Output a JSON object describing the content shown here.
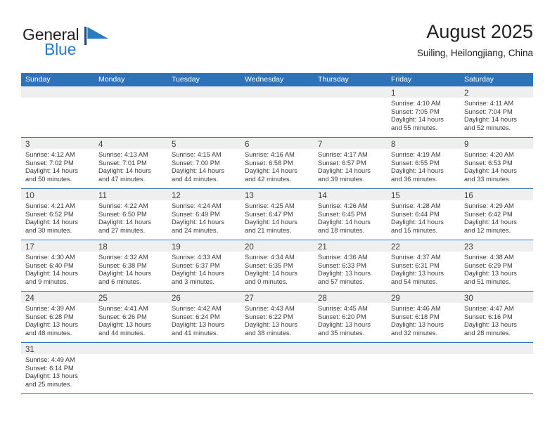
{
  "brand": {
    "name_top": "General",
    "name_bottom": "Blue",
    "flag_icon": "blue-flag-triangle-icon",
    "color_top": "#231f20",
    "color_bottom": "#2b7bbf"
  },
  "header": {
    "title": "August 2025",
    "subtitle": "Suiling, Heilongjiang, China"
  },
  "theme": {
    "header_blue": "#2e73b8",
    "day_band_gray": "#efefef",
    "text_dark": "#3a3a3a"
  },
  "weekdays": [
    "Sunday",
    "Monday",
    "Tuesday",
    "Wednesday",
    "Thursday",
    "Friday",
    "Saturday"
  ],
  "weeks": [
    [
      {
        "day": "",
        "lines": []
      },
      {
        "day": "",
        "lines": []
      },
      {
        "day": "",
        "lines": []
      },
      {
        "day": "",
        "lines": []
      },
      {
        "day": "",
        "lines": []
      },
      {
        "day": "1",
        "lines": [
          "Sunrise: 4:10 AM",
          "Sunset: 7:05 PM",
          "Daylight: 14 hours",
          "and 55 minutes."
        ]
      },
      {
        "day": "2",
        "lines": [
          "Sunrise: 4:11 AM",
          "Sunset: 7:04 PM",
          "Daylight: 14 hours",
          "and 52 minutes."
        ]
      }
    ],
    [
      {
        "day": "3",
        "lines": [
          "Sunrise: 4:12 AM",
          "Sunset: 7:02 PM",
          "Daylight: 14 hours",
          "and 50 minutes."
        ]
      },
      {
        "day": "4",
        "lines": [
          "Sunrise: 4:13 AM",
          "Sunset: 7:01 PM",
          "Daylight: 14 hours",
          "and 47 minutes."
        ]
      },
      {
        "day": "5",
        "lines": [
          "Sunrise: 4:15 AM",
          "Sunset: 7:00 PM",
          "Daylight: 14 hours",
          "and 44 minutes."
        ]
      },
      {
        "day": "6",
        "lines": [
          "Sunrise: 4:16 AM",
          "Sunset: 6:58 PM",
          "Daylight: 14 hours",
          "and 42 minutes."
        ]
      },
      {
        "day": "7",
        "lines": [
          "Sunrise: 4:17 AM",
          "Sunset: 6:57 PM",
          "Daylight: 14 hours",
          "and 39 minutes."
        ]
      },
      {
        "day": "8",
        "lines": [
          "Sunrise: 4:19 AM",
          "Sunset: 6:55 PM",
          "Daylight: 14 hours",
          "and 36 minutes."
        ]
      },
      {
        "day": "9",
        "lines": [
          "Sunrise: 4:20 AM",
          "Sunset: 6:53 PM",
          "Daylight: 14 hours",
          "and 33 minutes."
        ]
      }
    ],
    [
      {
        "day": "10",
        "lines": [
          "Sunrise: 4:21 AM",
          "Sunset: 6:52 PM",
          "Daylight: 14 hours",
          "and 30 minutes."
        ]
      },
      {
        "day": "11",
        "lines": [
          "Sunrise: 4:22 AM",
          "Sunset: 6:50 PM",
          "Daylight: 14 hours",
          "and 27 minutes."
        ]
      },
      {
        "day": "12",
        "lines": [
          "Sunrise: 4:24 AM",
          "Sunset: 6:49 PM",
          "Daylight: 14 hours",
          "and 24 minutes."
        ]
      },
      {
        "day": "13",
        "lines": [
          "Sunrise: 4:25 AM",
          "Sunset: 6:47 PM",
          "Daylight: 14 hours",
          "and 21 minutes."
        ]
      },
      {
        "day": "14",
        "lines": [
          "Sunrise: 4:26 AM",
          "Sunset: 6:45 PM",
          "Daylight: 14 hours",
          "and 18 minutes."
        ]
      },
      {
        "day": "15",
        "lines": [
          "Sunrise: 4:28 AM",
          "Sunset: 6:44 PM",
          "Daylight: 14 hours",
          "and 15 minutes."
        ]
      },
      {
        "day": "16",
        "lines": [
          "Sunrise: 4:29 AM",
          "Sunset: 6:42 PM",
          "Daylight: 14 hours",
          "and 12 minutes."
        ]
      }
    ],
    [
      {
        "day": "17",
        "lines": [
          "Sunrise: 4:30 AM",
          "Sunset: 6:40 PM",
          "Daylight: 14 hours",
          "and 9 minutes."
        ]
      },
      {
        "day": "18",
        "lines": [
          "Sunrise: 4:32 AM",
          "Sunset: 6:38 PM",
          "Daylight: 14 hours",
          "and 6 minutes."
        ]
      },
      {
        "day": "19",
        "lines": [
          "Sunrise: 4:33 AM",
          "Sunset: 6:37 PM",
          "Daylight: 14 hours",
          "and 3 minutes."
        ]
      },
      {
        "day": "20",
        "lines": [
          "Sunrise: 4:34 AM",
          "Sunset: 6:35 PM",
          "Daylight: 14 hours",
          "and 0 minutes."
        ]
      },
      {
        "day": "21",
        "lines": [
          "Sunrise: 4:36 AM",
          "Sunset: 6:33 PM",
          "Daylight: 13 hours",
          "and 57 minutes."
        ]
      },
      {
        "day": "22",
        "lines": [
          "Sunrise: 4:37 AM",
          "Sunset: 6:31 PM",
          "Daylight: 13 hours",
          "and 54 minutes."
        ]
      },
      {
        "day": "23",
        "lines": [
          "Sunrise: 4:38 AM",
          "Sunset: 6:29 PM",
          "Daylight: 13 hours",
          "and 51 minutes."
        ]
      }
    ],
    [
      {
        "day": "24",
        "lines": [
          "Sunrise: 4:39 AM",
          "Sunset: 6:28 PM",
          "Daylight: 13 hours",
          "and 48 minutes."
        ]
      },
      {
        "day": "25",
        "lines": [
          "Sunrise: 4:41 AM",
          "Sunset: 6:26 PM",
          "Daylight: 13 hours",
          "and 44 minutes."
        ]
      },
      {
        "day": "26",
        "lines": [
          "Sunrise: 4:42 AM",
          "Sunset: 6:24 PM",
          "Daylight: 13 hours",
          "and 41 minutes."
        ]
      },
      {
        "day": "27",
        "lines": [
          "Sunrise: 4:43 AM",
          "Sunset: 6:22 PM",
          "Daylight: 13 hours",
          "and 38 minutes."
        ]
      },
      {
        "day": "28",
        "lines": [
          "Sunrise: 4:45 AM",
          "Sunset: 6:20 PM",
          "Daylight: 13 hours",
          "and 35 minutes."
        ]
      },
      {
        "day": "29",
        "lines": [
          "Sunrise: 4:46 AM",
          "Sunset: 6:18 PM",
          "Daylight: 13 hours",
          "and 32 minutes."
        ]
      },
      {
        "day": "30",
        "lines": [
          "Sunrise: 4:47 AM",
          "Sunset: 6:16 PM",
          "Daylight: 13 hours",
          "and 28 minutes."
        ]
      }
    ],
    [
      {
        "day": "31",
        "lines": [
          "Sunrise: 4:49 AM",
          "Sunset: 6:14 PM",
          "Daylight: 13 hours",
          "and 25 minutes."
        ]
      },
      {
        "day": "",
        "lines": []
      },
      {
        "day": "",
        "lines": []
      },
      {
        "day": "",
        "lines": []
      },
      {
        "day": "",
        "lines": []
      },
      {
        "day": "",
        "lines": []
      },
      {
        "day": "",
        "lines": []
      }
    ]
  ]
}
